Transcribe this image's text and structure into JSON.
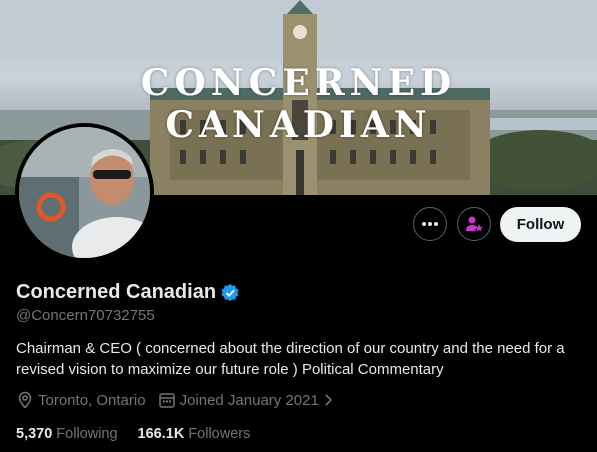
{
  "banner": {
    "title": "CONCERNED CANADIAN"
  },
  "profile": {
    "display_name": "Concerned Canadian",
    "handle": "@Concern70732755",
    "bio": "Chairman & CEO ( concerned about the direction of our country and the need for a revised vision to maximize our future role ) Political Commentary",
    "location": "Toronto, Ontario",
    "joined": "Joined January 2021",
    "following_count": "5,370",
    "following_label": "Following",
    "followers_count": "166.1K",
    "followers_label": "Followers"
  },
  "actions": {
    "follow_label": "Follow"
  },
  "icons": {
    "more": "more-icon",
    "subscribe": "subscribe-person-star-icon",
    "verified": "verified-badge-icon",
    "location": "location-pin-icon",
    "calendar": "calendar-icon",
    "chevron": "chevron-right-icon"
  },
  "colors": {
    "verified": "#1d9bf0",
    "subscribe_accent": "#c936cc",
    "follow_bg": "#eff3f4"
  }
}
